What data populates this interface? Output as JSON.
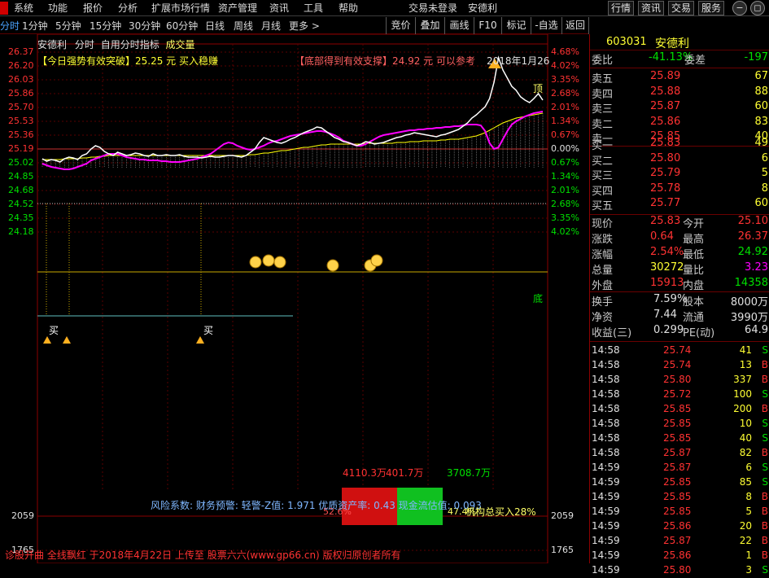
{
  "menu": {
    "items": [
      "系统",
      "功能",
      "报价",
      "分析",
      "扩展市场行情",
      "资产管理",
      "资讯",
      "工具",
      "帮助"
    ],
    "status": "交易未登录",
    "stock_name": "安德利",
    "right_buttons": [
      "行情",
      "资讯",
      "交易",
      "服务"
    ]
  },
  "periods": {
    "active": "分时",
    "items": [
      "1分钟",
      "5分钟",
      "15分钟",
      "30分钟",
      "60分钟",
      "日线",
      "周线",
      "月线",
      "更多 >"
    ]
  },
  "toolbar": [
    "竞价",
    "叠加",
    "画线",
    "F10",
    "标记",
    "-自选",
    "返回"
  ],
  "chart": {
    "subtitle": {
      "name": "安德利",
      "mode": "分时",
      "indicator": "自用分时指标",
      "volume": "成交量"
    },
    "price_labels": [
      "26.37",
      "26.20",
      "26.03",
      "25.86",
      "25.70",
      "25.53",
      "25.36",
      "25.19",
      "25.02",
      "24.85",
      "24.68",
      "24.52",
      "24.35",
      "24.18"
    ],
    "pct_labels": [
      "4.68%",
      "4.02%",
      "3.35%",
      "2.68%",
      "2.01%",
      "1.34%",
      "0.67%",
      "0.00%",
      "0.67%",
      "1.34%",
      "2.01%",
      "2.68%",
      "3.35%",
      "4.02%"
    ],
    "vol_labels": {
      "top": "2059",
      "bottom": "1765"
    },
    "ann_left": "【今日强势有效突破】25.25 元 买入稳赚",
    "ann_right": "【底部得到有效支撑】24.92 元 可以参考",
    "date_mark": "2018年1月26",
    "top_mark": "顶",
    "bottom_mark": "底",
    "buy_mark": "买",
    "buy_mark2": "买",
    "vol_a": "4110.3万",
    "vol_b": "401.7万",
    "vol_c": "3708.7万",
    "pct_a": "52.6%",
    "pct_b": "47.4%",
    "risk_text": "风险系数: 财务预警: 轻警-Z值: 1.971 优质资产率: 0.43 现金流估值: 0.093",
    "inst_text": "机构总买入28%",
    "footer": "诊股开曲 全线飘红 于2018年4月22日 上传至 股票六六(www.gp66.cn) 版权归原创者所有",
    "colors": {
      "up": "#ff3232",
      "down": "#00e000",
      "price_line": "#ffffff",
      "avg_line": "#ffff00",
      "indicator": "#ff00ff"
    },
    "price_series": [
      25.06,
      25.03,
      25.05,
      25.04,
      25.02,
      25.06,
      25.08,
      25.07,
      25.05,
      25.1,
      25.12,
      25.18,
      25.22,
      25.2,
      25.15,
      25.12,
      25.1,
      25.14,
      25.12,
      25.1,
      25.11,
      25.13,
      25.12,
      25.1,
      25.09,
      25.12,
      25.1,
      25.1,
      25.11,
      25.1,
      25.1,
      25.11,
      25.09,
      25.08,
      25.08,
      25.08,
      25.07,
      25.08,
      25.09,
      25.08,
      25.08,
      25.09,
      25.1,
      25.1,
      25.09,
      25.08,
      25.1,
      25.14,
      25.18,
      25.26,
      25.32,
      25.3,
      25.28,
      25.26,
      25.25,
      25.27,
      25.3,
      25.32,
      25.35,
      25.38,
      25.4,
      25.42,
      25.45,
      25.44,
      25.4,
      25.36,
      25.32,
      25.3,
      25.27,
      25.26,
      25.24,
      25.22,
      25.24,
      25.27,
      25.26,
      25.24,
      25.25,
      25.26,
      25.28,
      25.3,
      25.32,
      25.33,
      25.35,
      25.36,
      25.38,
      25.37,
      25.36,
      25.35,
      25.34,
      25.33,
      25.35,
      25.36,
      25.38,
      25.4,
      25.42,
      25.46,
      25.5,
      25.56,
      25.6,
      25.65,
      25.7,
      25.8,
      26.0,
      26.3,
      26.15,
      26.05,
      25.95,
      25.9,
      25.82,
      25.78,
      25.75,
      25.8,
      25.86,
      25.78
    ],
    "avg_series": [
      25.05,
      25.05,
      25.05,
      25.05,
      25.05,
      25.06,
      25.06,
      25.06,
      25.06,
      25.07,
      25.07,
      25.08,
      25.08,
      25.09,
      25.09,
      25.1,
      25.1,
      25.1,
      25.1,
      25.1,
      25.1,
      25.1,
      25.1,
      25.1,
      25.1,
      25.1,
      25.1,
      25.1,
      25.1,
      25.1,
      25.1,
      25.1,
      25.1,
      25.1,
      25.1,
      25.1,
      25.1,
      25.1,
      25.1,
      25.1,
      25.1,
      25.1,
      25.1,
      25.1,
      25.1,
      25.1,
      25.1,
      25.11,
      25.11,
      25.12,
      25.13,
      25.13,
      25.14,
      25.15,
      25.16,
      25.16,
      25.17,
      25.18,
      25.19,
      25.2,
      25.2,
      25.21,
      25.22,
      25.23,
      25.23,
      25.24,
      25.24,
      25.24,
      25.24,
      25.24,
      25.24,
      25.24,
      25.24,
      25.25,
      25.25,
      25.25,
      25.25,
      25.25,
      25.25,
      25.25,
      25.26,
      25.26,
      25.26,
      25.27,
      25.27,
      25.27,
      25.28,
      25.28,
      25.28,
      25.28,
      25.29,
      25.29,
      25.3,
      25.3,
      25.3,
      25.31,
      25.32,
      25.33,
      25.34,
      25.36,
      25.38,
      25.41,
      25.44,
      25.47,
      25.5,
      25.52,
      25.54,
      25.56,
      25.57,
      25.58,
      25.59,
      25.6,
      25.61,
      25.62
    ],
    "ind_series": [
      25.0,
      24.98,
      24.96,
      24.95,
      24.94,
      24.93,
      24.93,
      24.94,
      24.96,
      24.98,
      25.0,
      25.04,
      25.06,
      25.08,
      25.1,
      25.12,
      25.12,
      25.12,
      25.1,
      25.08,
      25.07,
      25.06,
      25.05,
      25.05,
      25.04,
      25.04,
      25.04,
      25.03,
      25.03,
      25.02,
      25.02,
      25.02,
      25.03,
      25.04,
      25.05,
      25.06,
      25.08,
      25.1,
      25.12,
      25.16,
      25.2,
      25.24,
      25.26,
      25.25,
      25.22,
      25.2,
      25.18,
      25.17,
      25.18,
      25.2,
      25.22,
      25.25,
      25.27,
      25.28,
      25.3,
      25.32,
      25.34,
      25.35,
      25.36,
      25.37,
      25.38,
      25.39,
      25.4,
      25.4,
      25.39,
      25.37,
      25.35,
      25.32,
      25.28,
      25.26,
      25.24,
      25.22,
      25.22,
      25.24,
      25.27,
      25.3,
      25.33,
      25.35,
      25.36,
      25.37,
      25.38,
      25.39,
      25.4,
      25.41,
      25.41,
      25.42,
      25.42,
      25.43,
      25.43,
      25.44,
      25.44,
      25.45,
      25.45,
      25.46,
      25.46,
      25.47,
      25.48,
      25.48,
      25.48,
      25.47,
      25.4,
      25.25,
      25.18,
      25.2,
      25.3,
      25.4,
      25.48,
      25.52,
      25.55,
      25.58,
      25.6,
      25.62,
      25.63,
      25.64
    ]
  },
  "side": {
    "code": "603031",
    "name": "安德利",
    "webi": {
      "label": "委比",
      "value": "-41.13%",
      "label2": "委差",
      "value2": "-197"
    },
    "asks": [
      {
        "label": "卖五",
        "price": "25.89",
        "vol": "67"
      },
      {
        "label": "卖四",
        "price": "25.88",
        "vol": "88"
      },
      {
        "label": "卖三",
        "price": "25.87",
        "vol": "60"
      },
      {
        "label": "卖二",
        "price": "25.86",
        "vol": "83"
      },
      {
        "label": "卖一",
        "price": "25.85",
        "vol": "40"
      }
    ],
    "bids": [
      {
        "label": "买一",
        "price": "25.83",
        "vol": "49"
      },
      {
        "label": "买二",
        "price": "25.80",
        "vol": "6"
      },
      {
        "label": "买三",
        "price": "25.79",
        "vol": "5"
      },
      {
        "label": "买四",
        "price": "25.78",
        "vol": "8"
      },
      {
        "label": "买五",
        "price": "25.77",
        "vol": "60"
      }
    ],
    "stats": [
      {
        "l1": "现价",
        "v1": "25.83",
        "l2": "今开",
        "v2": "25.10"
      },
      {
        "l1": "涨跌",
        "v1": "0.64",
        "l2": "最高",
        "v2": "26.37"
      },
      {
        "l1": "涨幅",
        "v1": "2.54%",
        "l2": "最低",
        "v2": "24.92"
      },
      {
        "l1": "总量",
        "v1": "30272",
        "l2": "量比",
        "v2": "3.23"
      },
      {
        "l1": "外盘",
        "v1": "15913",
        "l2": "内盘",
        "v2": "14358"
      }
    ],
    "stats2": [
      {
        "l1": "换手",
        "v1": "7.59%",
        "l2": "股本",
        "v2": "8000万"
      },
      {
        "l1": "净资",
        "v1": "7.44",
        "l2": "流通",
        "v2": "3990万"
      },
      {
        "l1": "收益(三)",
        "v1": "0.299",
        "l2": "PE(动)",
        "v2": "64.9"
      }
    ],
    "ticks": [
      {
        "t": "14:58",
        "p": "25.74",
        "v": "41",
        "s": "S"
      },
      {
        "t": "14:58",
        "p": "25.74",
        "v": "13",
        "s": "B"
      },
      {
        "t": "14:58",
        "p": "25.80",
        "v": "337",
        "s": "B"
      },
      {
        "t": "14:58",
        "p": "25.72",
        "v": "100",
        "s": "S"
      },
      {
        "t": "14:58",
        "p": "25.85",
        "v": "200",
        "s": "B"
      },
      {
        "t": "14:58",
        "p": "25.85",
        "v": "10",
        "s": "S"
      },
      {
        "t": "14:58",
        "p": "25.85",
        "v": "40",
        "s": "S"
      },
      {
        "t": "14:58",
        "p": "25.87",
        "v": "82",
        "s": "B"
      },
      {
        "t": "14:59",
        "p": "25.87",
        "v": "6",
        "s": "S"
      },
      {
        "t": "14:59",
        "p": "25.85",
        "v": "85",
        "s": "S"
      },
      {
        "t": "14:59",
        "p": "25.85",
        "v": "8",
        "s": "B"
      },
      {
        "t": "14:59",
        "p": "25.85",
        "v": "5",
        "s": "B"
      },
      {
        "t": "14:59",
        "p": "25.86",
        "v": "20",
        "s": "B"
      },
      {
        "t": "14:59",
        "p": "25.87",
        "v": "22",
        "s": "B"
      },
      {
        "t": "14:59",
        "p": "25.86",
        "v": "1",
        "s": "B"
      },
      {
        "t": "14:59",
        "p": "25.80",
        "v": "3",
        "s": "S"
      }
    ]
  }
}
